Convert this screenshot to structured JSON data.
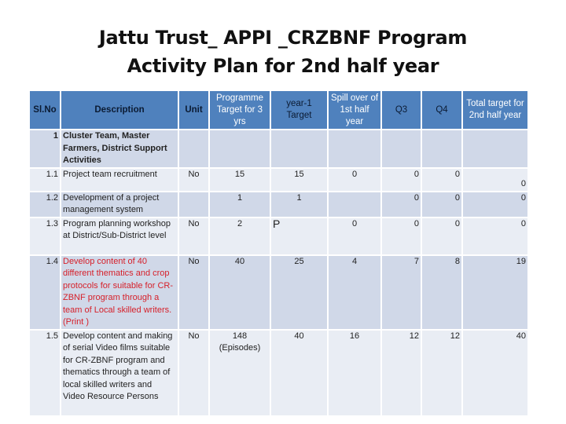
{
  "title": {
    "line1": "Jattu Trust_ APPI _CRZBNF Program",
    "line2": "Activity Plan for 2nd half year"
  },
  "table": {
    "headers": {
      "slno": "Sl.No",
      "description": "Description",
      "unit": "Unit",
      "programme_target": "Programme Target for 3 yrs",
      "year1_target": "year-1 Target",
      "spill_over": "Spill over of 1st  half year",
      "q3": "Q3",
      "q4": "Q4",
      "total_target": "Total target for 2nd half year"
    },
    "rows": [
      {
        "slno": "1",
        "description": "Cluster Team, Master Farmers, District Support Activities",
        "unit": "",
        "programme_target": "",
        "year1_target": "",
        "spill_over": "",
        "q3": "",
        "q4": "",
        "total_target": ""
      },
      {
        "slno": "1.1",
        "description": "Project team recruitment",
        "unit": "No",
        "programme_target": "15",
        "year1_target": "15",
        "spill_over": "0",
        "q3": "0",
        "q4": "0",
        "total_target": "0"
      },
      {
        "slno": "1.2",
        "description": "Development of a project management system",
        "unit": "",
        "programme_target": "1",
        "year1_target": "1",
        "spill_over": "",
        "q3": "0",
        "q4": "0",
        "total_target": "0"
      },
      {
        "slno": "1.3",
        "description": "Program planning workshop at District/Sub-District level",
        "unit": "No",
        "programme_target": "2",
        "year1_target": "P",
        "spill_over": "0",
        "q3": "0",
        "q4": "0",
        "total_target": "0"
      },
      {
        "slno": "1.4",
        "description": "Develop content of 40 different  thematics and crop protocols for suitable for CR-ZBNF program through a team of Local skilled writers. (Print )",
        "unit": "No",
        "programme_target": "40",
        "year1_target": "25",
        "spill_over": "4",
        "q3": "7",
        "q4": "8",
        "total_target": "19"
      },
      {
        "slno": "1.5",
        "description": "Develop content and making of  serial Video films suitable for CR-ZBNF program and thematics through a team of local skilled writers and Video Resource Persons",
        "unit": "No",
        "programme_target": "148 (Episodes)",
        "year1_target": "40",
        "spill_over": "16",
        "q3": "12",
        "q4": "12",
        "total_target": "40"
      }
    ]
  },
  "colors": {
    "header_bg": "#4f81bd",
    "row_dark": "#d0d8e8",
    "row_light": "#e9edf4",
    "highlight_text": "#d6202a"
  }
}
